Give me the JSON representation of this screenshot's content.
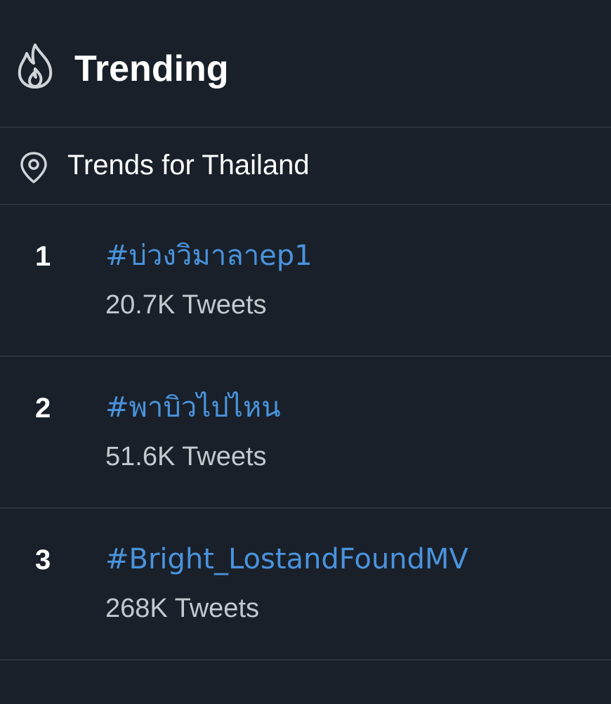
{
  "header": {
    "title": "Trending",
    "icon": "flame-icon"
  },
  "location": {
    "label": "Trends for Thailand",
    "icon": "location-pin-icon"
  },
  "trends": [
    {
      "rank": "1",
      "tag": "#บ่วงวิมาลาep1",
      "count": "20.7K Tweets"
    },
    {
      "rank": "2",
      "tag": "#พาบิวไปไหน",
      "count": "51.6K Tweets"
    },
    {
      "rank": "3",
      "tag": "#Bright_LostandFoundMV",
      "count": "268K Tweets"
    }
  ],
  "colors": {
    "background": "#192029",
    "divider": "#2a323d",
    "link": "#4a93dd",
    "secondary_text": "#c4c9cf",
    "primary_text": "#ffffff"
  }
}
